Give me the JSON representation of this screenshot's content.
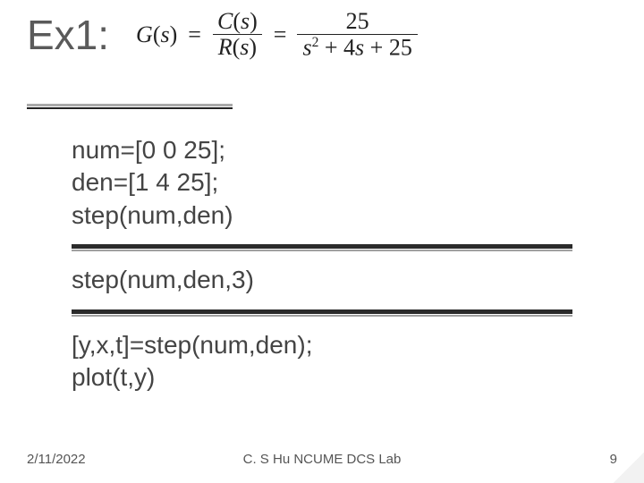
{
  "title": "Ex1:",
  "equation": {
    "lhs": "G",
    "lhs_arg": "s",
    "frac1": {
      "num_fn": "C",
      "num_arg": "s",
      "den_fn": "R",
      "den_arg": "s"
    },
    "frac2": {
      "num": "25",
      "den_a": "s",
      "den_exp": "2",
      "den_plus1": "+ 4",
      "den_s": "s",
      "den_plus2": "+ 25"
    }
  },
  "code": {
    "block1": {
      "line1": "num=[0 0 25];",
      "line2": "den=[1 4 25];",
      "line3": "step(num,den)"
    },
    "block2": {
      "line1": "step(num,den,3)"
    },
    "block3": {
      "line1": "[y,x,t]=step(num,den);",
      "line2": "plot(t,y)"
    }
  },
  "footer": {
    "date": "2/11/2022",
    "center": "C. S Hu   NCUME DCS Lab",
    "page": "9"
  }
}
